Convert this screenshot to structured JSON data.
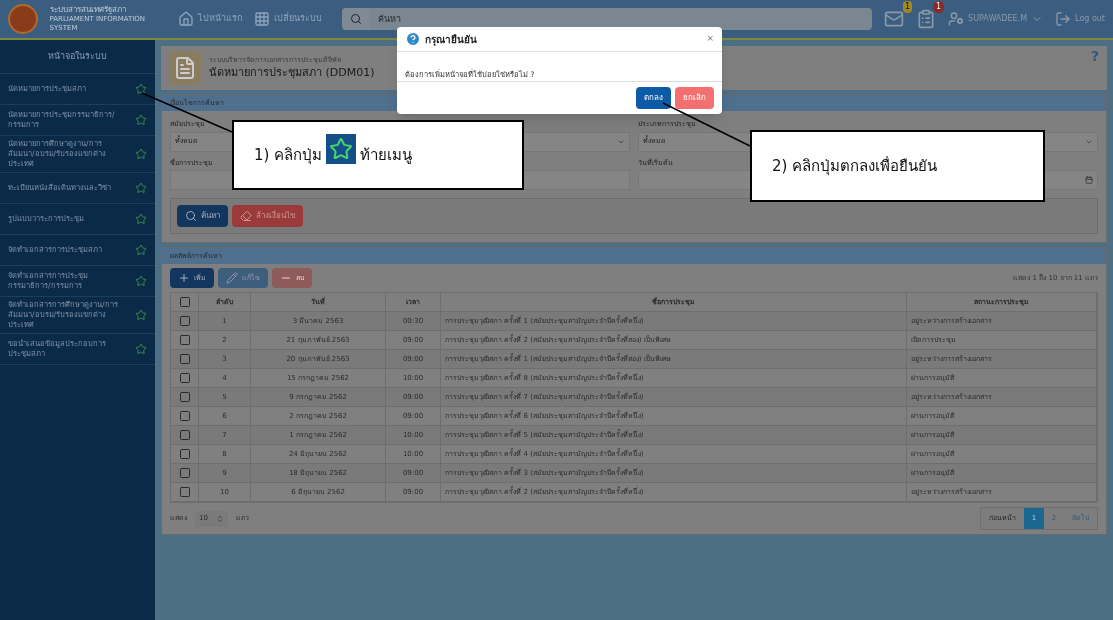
{
  "header": {
    "system_name": "ระบบสารสนเทศรัฐสภา",
    "system_subtitle": "PARLIAMENT INFORMATION SYSTEM",
    "home_link": "ไปหน้าแรก",
    "switch_link": "เปลี่ยนระบบ",
    "search": {
      "placeholder": "ค้นหา"
    },
    "mail_badge": "1",
    "notify_badge": "1",
    "user": "SUPAWADEE.M",
    "logout": "Log out"
  },
  "sidebar": {
    "title": "หน้าจอในระบบ",
    "items": [
      {
        "label": "นัดหมายการประชุมสภา"
      },
      {
        "label": "นัดหมายการประชุมกรรมาธิการ/กรรมการ"
      },
      {
        "label": "นัดหมายการศึกษาดูงาน/การสัมมนา/อบรม/รับรองแขกต่างประเทศ"
      },
      {
        "label": "ทะเบียนหนังสือเดินทางและวีซ่า"
      },
      {
        "label": "รูปแบบวาระการประชุม"
      },
      {
        "label": "จัดทำเอกสารการประชุมสภา"
      },
      {
        "label": "จัดทำเอกสารการประชุมกรรมาธิการ/กรรมการ"
      },
      {
        "label": "จัดทำเอกสารการศึกษาดูงาน/การสัมมนา/อบรม/รับรองแขกต่างประเทศ"
      },
      {
        "label": "ขอนำเสนอข้อมูลประกอบการประชุมสภา"
      }
    ]
  },
  "page": {
    "subtitle": "ระบบบริหารจัดการเอกสารการประชุมดิจิทัล",
    "title": "นัดหมายการประชุมสภา (DDM01)",
    "help": "?"
  },
  "search_panel": {
    "title": "เงื่อนไขการค้นหา",
    "session_label": "สมัยประชุม",
    "session_value": "ทั้งหมด",
    "type_label": "ประเภทการประชุม",
    "type_value": "ทั้งหมด",
    "name_label": "ชื่อการประชุม",
    "start_label": "วันที่เริ่มต้น",
    "search_button": "ค้นหา",
    "clear_button": "ล้างเงื่อนไข"
  },
  "results": {
    "title": "ผลลัพธ์การค้นหา",
    "add_button": "เพิ่ม",
    "edit_button": "แก้ไข",
    "delete_button": "ลบ",
    "summary": "แสดง 1 ถึง 10 จาก 11 แถว",
    "select_all_checked": false,
    "columns": [
      "ลำดับ",
      "วันที่",
      "เวลา",
      "ชื่อการประชุม",
      "สถานะการประชุม"
    ],
    "rows": [
      {
        "checked": false,
        "cells": [
          "1",
          "3 มีนาคม 2563",
          "00:30",
          "การประชุมวุฒิสภา ครั้งที่ 1 (สมัยประชุมสามัญประจำปีครั้งที่หนึ่ง)",
          "อยู่ระหว่างการสร้างเอกสาร"
        ]
      },
      {
        "checked": false,
        "cells": [
          "2",
          "21 กุมภาพันธ์ 2563",
          "09:00",
          "การประชุมวุฒิสภา ครั้งที่ 2 (สมัยประชุมสามัญประจำปีครั้งที่สอง) เป็นพิเศษ",
          "เปิดการประชุม"
        ]
      },
      {
        "checked": false,
        "cells": [
          "3",
          "20 กุมภาพันธ์ 2563",
          "09:00",
          "การประชุมวุฒิสภา ครั้งที่ 1 (สมัยประชุมสามัญประจำปีครั้งที่สอง) เป็นพิเศษ",
          "อยู่ระหว่างการสร้างเอกสาร"
        ]
      },
      {
        "checked": false,
        "cells": [
          "4",
          "15 กรกฎาคม 2562",
          "10:00",
          "การประชุมวุฒิสภา ครั้งที่ 8 (สมัยประชุมสามัญประจำปีครั้งที่หนึ่ง)",
          "ผ่านการอนุมัติ"
        ]
      },
      {
        "checked": false,
        "cells": [
          "5",
          "9 กรกฎาคม 2562",
          "09:00",
          "การประชุมวุฒิสภา ครั้งที่ 7 (สมัยประชุมสามัญประจำปีครั้งที่หนึ่ง)",
          "อยู่ระหว่างการสร้างเอกสาร"
        ]
      },
      {
        "checked": false,
        "cells": [
          "6",
          "2 กรกฎาคม 2562",
          "09:00",
          "การประชุมวุฒิสภา ครั้งที่ 6 (สมัยประชุมสามัญประจำปีครั้งที่หนึ่ง)",
          "ผ่านการอนุมัติ"
        ]
      },
      {
        "checked": false,
        "cells": [
          "7",
          "1 กรกฎาคม 2562",
          "10:00",
          "การประชุมวุฒิสภา ครั้งที่ 5 (สมัยประชุมสามัญประจำปีครั้งที่หนึ่ง)",
          "ผ่านการอนุมัติ"
        ]
      },
      {
        "checked": false,
        "cells": [
          "8",
          "24 มิถุนายน 2562",
          "10:00",
          "การประชุมวุฒิสภา ครั้งที่ 4 (สมัยประชุมสามัญประจำปีครั้งที่หนึ่ง)",
          "ผ่านการอนุมัติ"
        ]
      },
      {
        "checked": false,
        "cells": [
          "9",
          "18 มิถุนายน 2562",
          "09:00",
          "การประชุมวุฒิสภา ครั้งที่ 3 (สมัยประชุมสามัญประจำปีครั้งที่หนึ่ง)",
          "ผ่านการอนุมัติ"
        ]
      },
      {
        "checked": false,
        "cells": [
          "10",
          "6 มิถุนายน 2562",
          "09:00",
          "การประชุมวุฒิสภา ครั้งที่ 2 (สมัยประชุมสามัญประจำปีครั้งที่หนึ่ง)",
          "อยู่ระหว่างการสร้างเอกสาร"
        ]
      }
    ],
    "page_size_before": "แสดง",
    "page_size": "10",
    "page_size_after": "แถว",
    "pagination": {
      "previous": "ก่อนหน้า",
      "pages": [
        {
          "label": "1",
          "selected": true
        },
        {
          "label": "2",
          "selected": false
        }
      ],
      "next": "ถัดไป"
    }
  },
  "dialog": {
    "title": "กรุณายืนยัน",
    "close": "×",
    "message": "ต้องการเพิ่มหน้าจอที่ใช้บ่อยใช่หรือไม่ ?",
    "ok": "ตกลง",
    "cancel": "ยกเลิก"
  },
  "callouts": [
    {
      "before": "1) คลิกปุ่ม",
      "after": "ท้ายเมนู"
    },
    {
      "before": "2) คลิกปุ่มตกลงเพื่อยืนยัน"
    }
  ]
}
